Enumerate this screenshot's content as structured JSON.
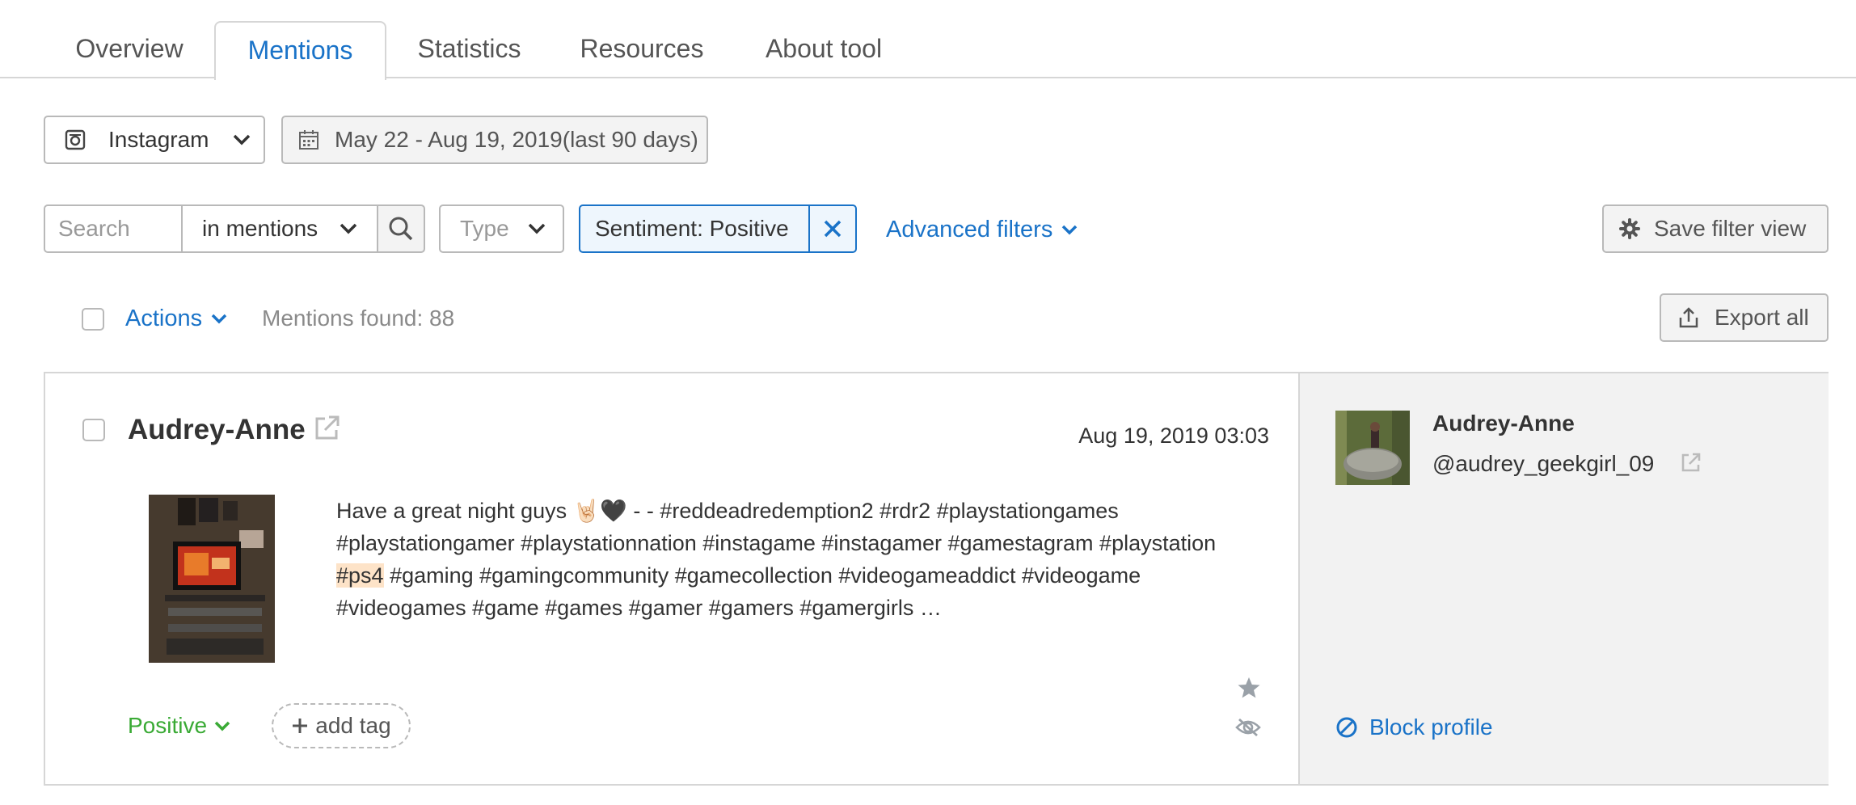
{
  "tabs": [
    {
      "label": "Overview"
    },
    {
      "label": "Mentions",
      "active": true
    },
    {
      "label": "Statistics"
    },
    {
      "label": "Resources"
    },
    {
      "label": "About tool"
    }
  ],
  "source": {
    "label": "Instagram",
    "icon": "instagram-icon"
  },
  "date_range": {
    "label": "May 22 - Aug 19, 2019(last 90 days)",
    "icon": "calendar-icon"
  },
  "search": {
    "placeholder": "Search",
    "scope": "in mentions"
  },
  "type_filter": {
    "label": "Type"
  },
  "sentiment_chip": {
    "label": "Sentiment: Positive"
  },
  "advanced_filters": {
    "label": "Advanced filters"
  },
  "save_filter": {
    "label": "Save filter view",
    "icon": "gear-icon"
  },
  "actions": {
    "label": "Actions"
  },
  "mentions_found": {
    "label": "Mentions found: 88"
  },
  "export": {
    "label": "Export all",
    "icon": "export-icon"
  },
  "mention": {
    "author": "Audrey-Anne",
    "date": "Aug 19, 2019 03:03",
    "text_before": "Have a great night guys 🤘🏻🖤 - - #reddeadredemption2 #rdr2 #playstationgames #playstationgamer #playstationnation #instagame #instagamer #gamestagram #playstation ",
    "text_highlight": "#ps4",
    "text_after": " #gaming #gamingcommunity #gamecollection #videogameaddict #videogame #videogames #game #games #gamer #gamers #gamergirls …",
    "sentiment": "Positive",
    "add_tag": "add tag",
    "profile": {
      "name": "Audrey-Anne",
      "handle": "@audrey_geekgirl_09",
      "block_label": "Block profile"
    }
  },
  "colors": {
    "accent": "#1a73c8",
    "positive": "#3aaa35",
    "highlight": "#fde3c8",
    "border": "#b9b9b9"
  }
}
